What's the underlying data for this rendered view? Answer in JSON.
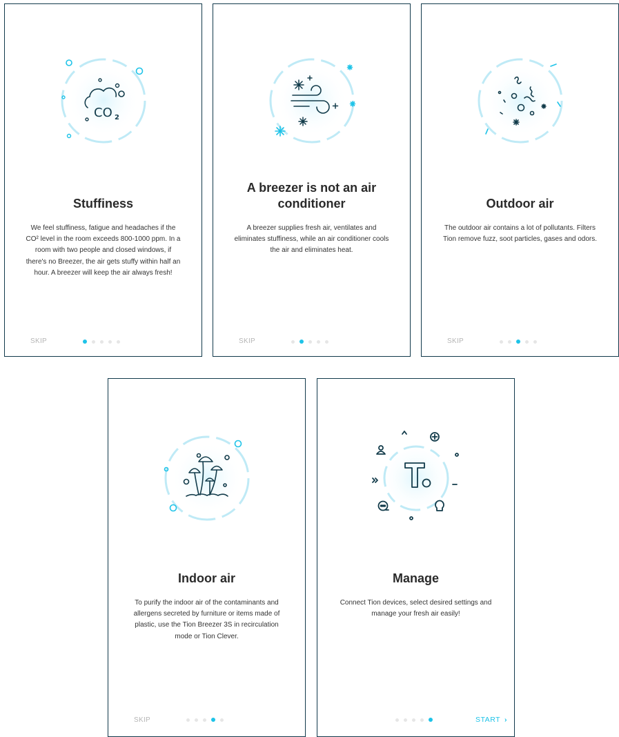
{
  "screens": [
    {
      "title": "Stuffiness",
      "body": "We feel stuffiness, fatigue and headaches if the CO² level in the room exceeds 800-1000 ppm. In a room with two people and closed windows, if there's no Breezer, the air gets stuffy within half an hour. A breezer will keep the air always fresh!",
      "skip": "SKIP",
      "active_page": 1,
      "icon": "co2-cloud-icon",
      "icon_text": "CO",
      "icon_sub": "2"
    },
    {
      "title": "A breezer is not an air conditioner",
      "body": "A breezer supplies fresh air, ventilates and eliminates stuffiness, while an air conditioner cools the air and eliminates heat.",
      "skip": "SKIP",
      "active_page": 2,
      "icon": "wind-snowflake-icon"
    },
    {
      "title": "Outdoor air",
      "body": "The outdoor air contains a lot of pollutants. Filters Tion remove fuzz, soot particles, gases and odors.",
      "skip": "SKIP",
      "active_page": 3,
      "icon": "pollutants-icon"
    },
    {
      "title": "Indoor air",
      "body": "To purify the indoor air of the contaminants and allergens secreted by furniture or items made of plastic, use the Tion Breezer 3S in recirculation mode or Tion Clever.",
      "skip": "SKIP",
      "active_page": 4,
      "icon": "mushroom-mold-icon"
    },
    {
      "title": "Manage",
      "body": "Connect Tion devices, select desired settings and manage your fresh air easily!",
      "start": "START",
      "active_page": 5,
      "icon": "tion-logo-icon",
      "logo_text": "T"
    }
  ],
  "page_count": 5,
  "colors": {
    "accent": "#1ec3e8",
    "ring": "#bfeaf6",
    "icon_stroke": "#123b4a",
    "card_border": "#10384a",
    "skip_text": "#b5b5b5",
    "dot_inactive": "#e6e6e6"
  }
}
